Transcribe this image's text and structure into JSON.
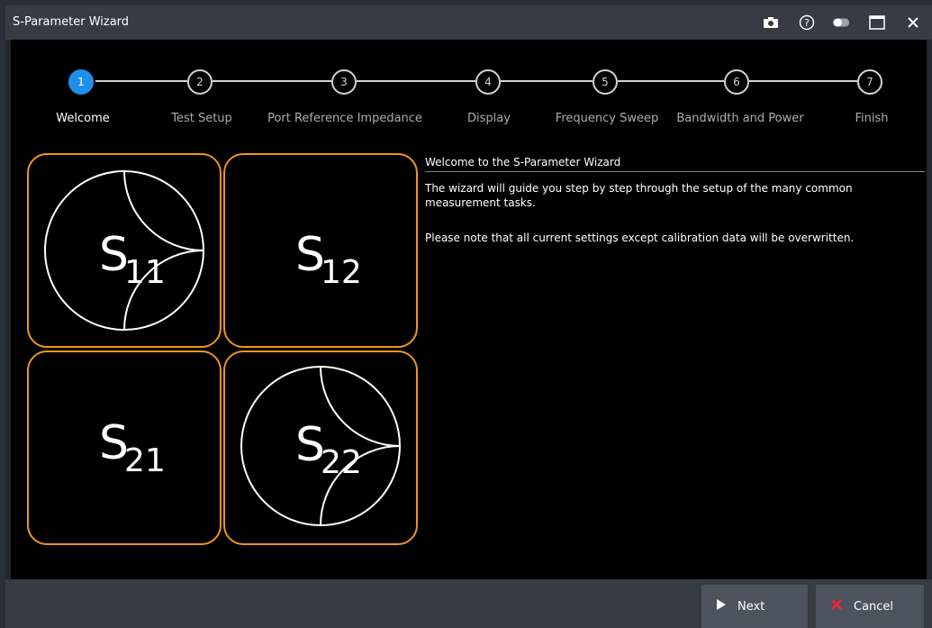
{
  "window": {
    "title": "S-Parameter Wizard"
  },
  "titlebar_icons": [
    "camera-icon",
    "help-icon",
    "toggle-icon",
    "maximize-icon",
    "close-icon"
  ],
  "steps": [
    {
      "number": "1",
      "label": "Welcome",
      "active": true
    },
    {
      "number": "2",
      "label": "Test Setup"
    },
    {
      "number": "3",
      "label": "Port Reference Impedance"
    },
    {
      "number": "4",
      "label": "Display"
    },
    {
      "number": "5",
      "label": "Frequency Sweep"
    },
    {
      "number": "6",
      "label": "Bandwidth and Power"
    },
    {
      "number": "7",
      "label": "Finish"
    }
  ],
  "tiles": [
    {
      "main": "S",
      "sub": "11",
      "smith_chart": true
    },
    {
      "main": "S",
      "sub": "12",
      "smith_chart": false
    },
    {
      "main": "S",
      "sub": "21",
      "smith_chart": false
    },
    {
      "main": "S",
      "sub": "22",
      "smith_chart": true
    }
  ],
  "info": {
    "title": "Welcome to the S-Parameter Wizard",
    "line1": "The wizard will guide you step by step through the setup of the many common",
    "line2": "measurement tasks.",
    "line3": "Please note that all current settings except calibration data will be overwritten."
  },
  "buttons": {
    "next": "Next",
    "cancel": "Cancel"
  },
  "colors": {
    "active_step": "#1e90e8",
    "tile_border": "#f0951f",
    "cancel_icon": "#e8283a"
  }
}
